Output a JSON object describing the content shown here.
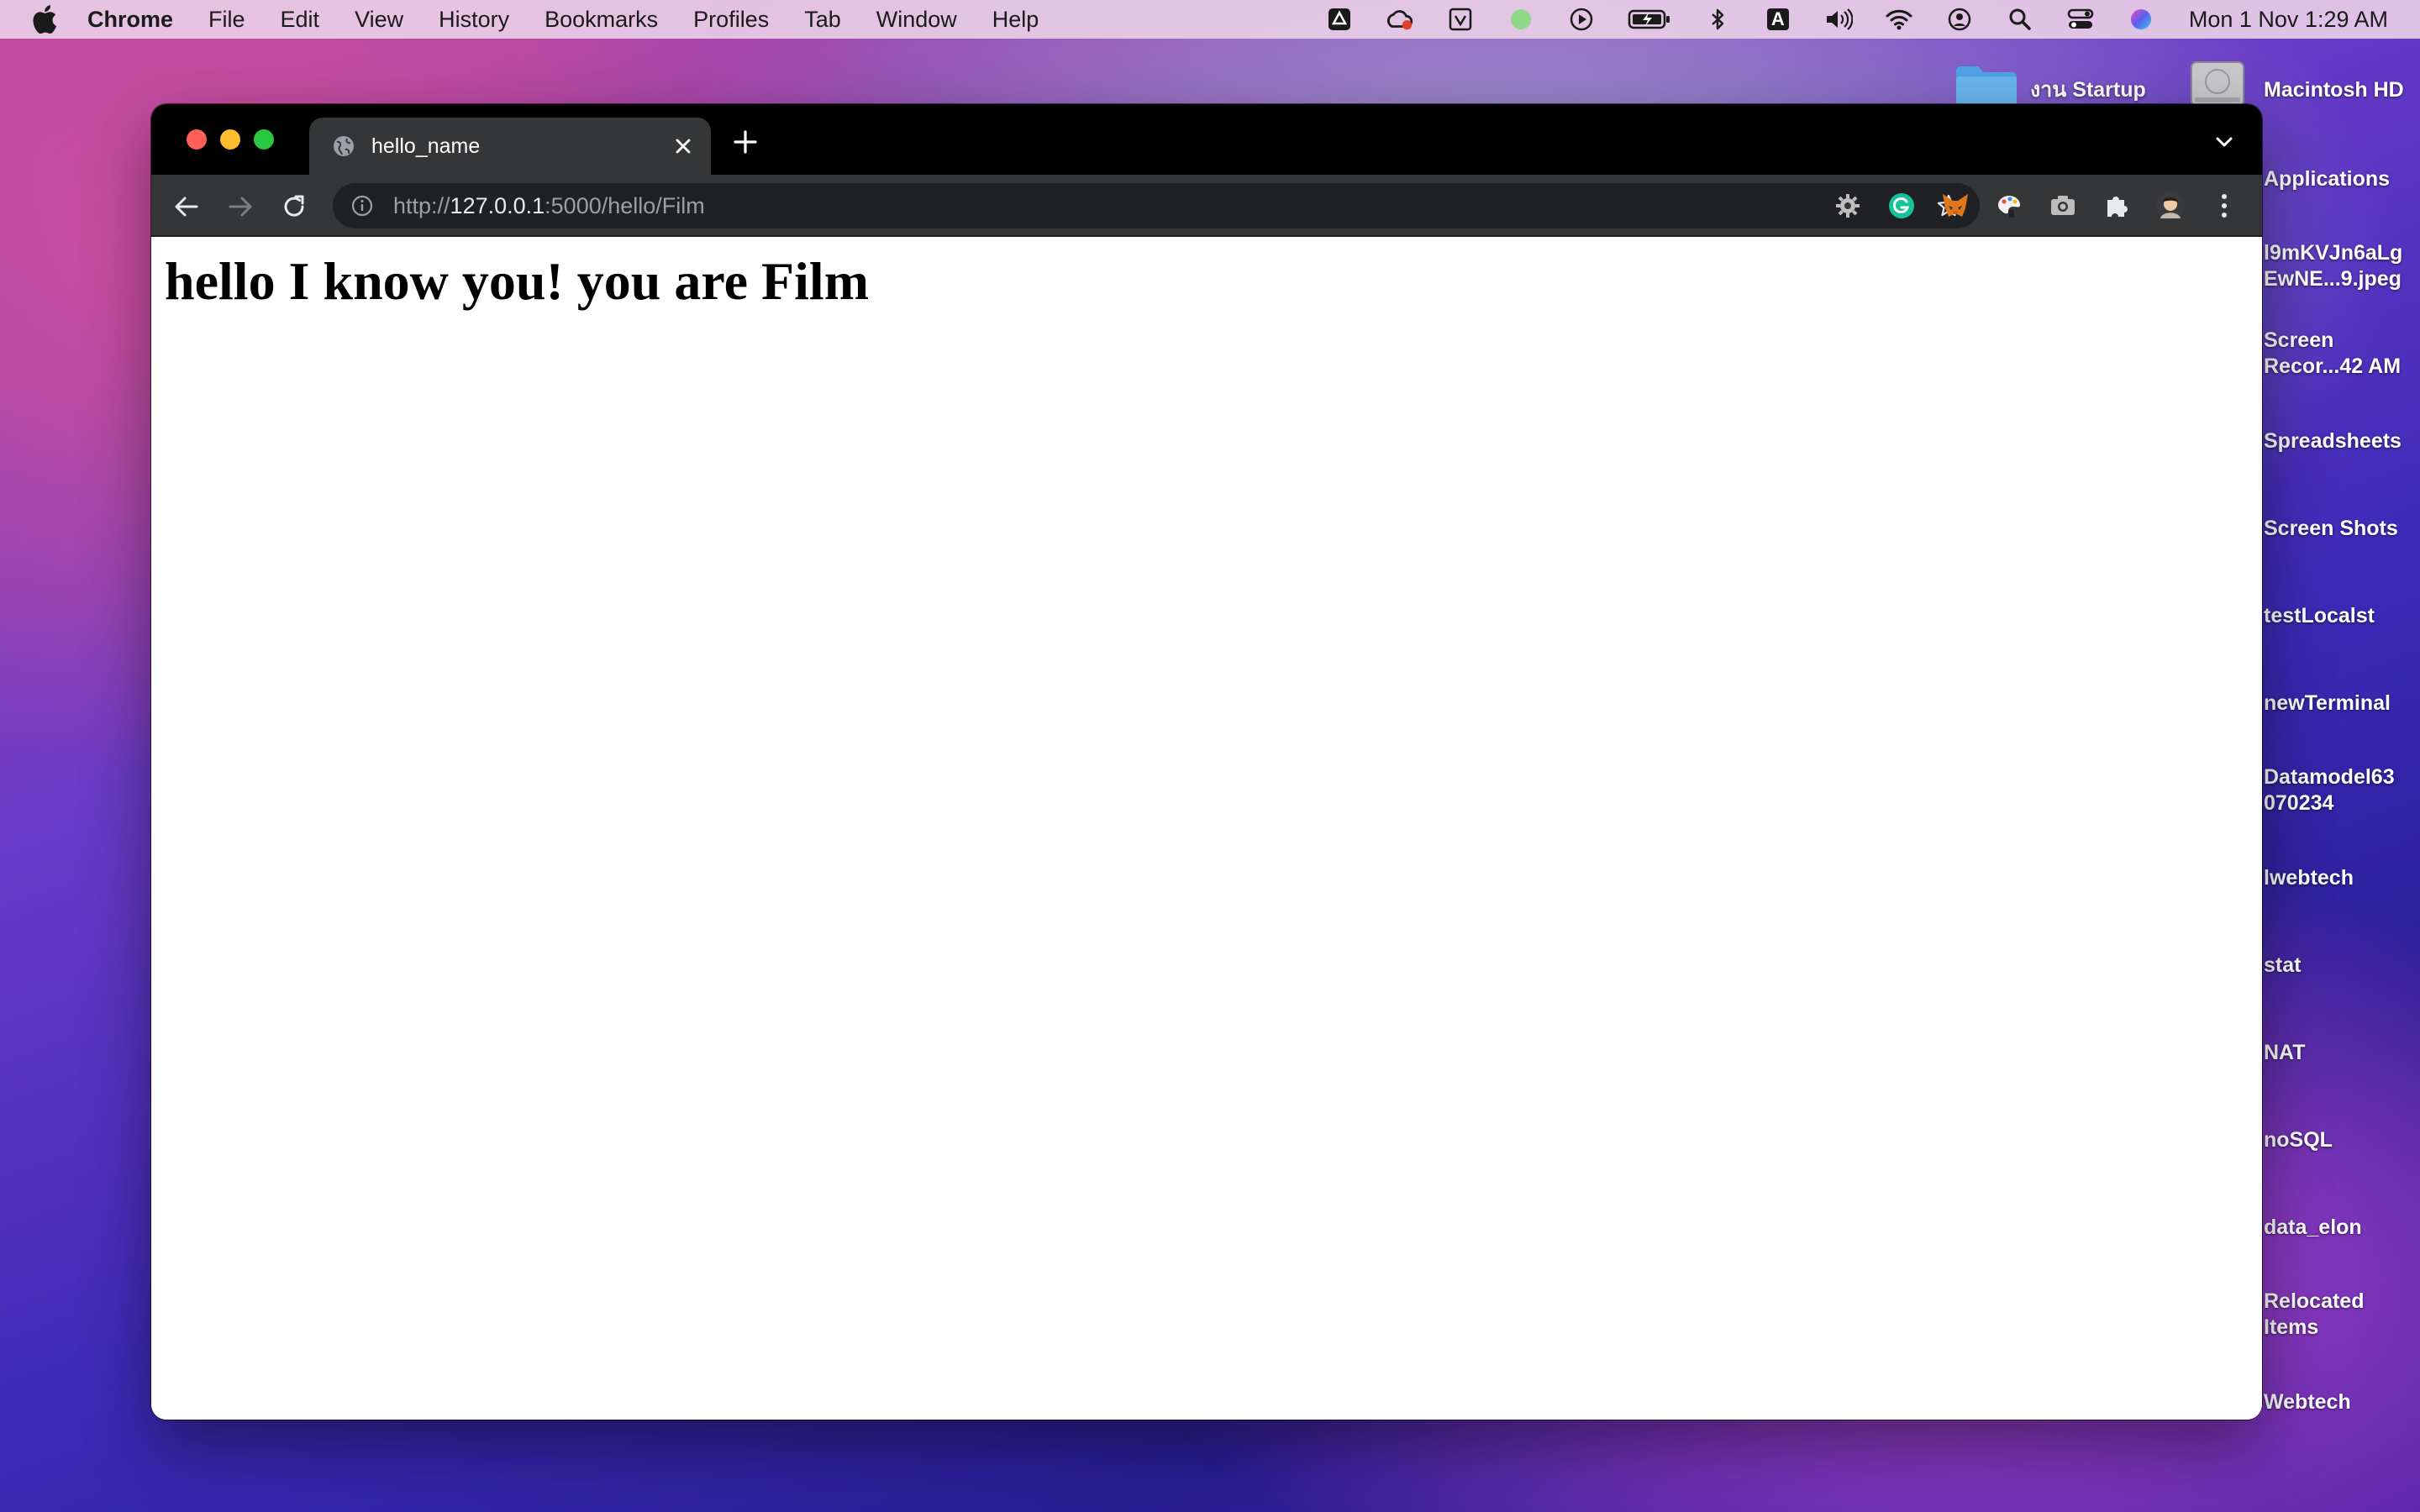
{
  "menubar": {
    "app_name": "Chrome",
    "items": [
      "File",
      "Edit",
      "View",
      "History",
      "Bookmarks",
      "Profiles",
      "Tab",
      "Window",
      "Help"
    ],
    "clock": "Mon 1 Nov  1:29 AM",
    "status_icons": [
      "drive-icon",
      "creative-cloud-icon",
      "vpn-shield-icon",
      "green-dot-icon",
      "play-icon",
      "battery-icon",
      "bluetooth-icon",
      "input-source-icon",
      "volume-icon",
      "wifi-icon",
      "user-icon",
      "spotlight-icon",
      "control-center-icon",
      "siri-icon"
    ],
    "input_source_label": "A"
  },
  "desktop": {
    "items": [
      {
        "label": "งาน Startup",
        "icon": "folder-icon"
      },
      {
        "label": "Macintosh HD",
        "icon": "hard-drive-icon"
      },
      {
        "label": "Applications"
      },
      {
        "label": "l9mKVJn6aLg\nEwNE...9.jpeg"
      },
      {
        "label": "Screen\nRecor...42 AM"
      },
      {
        "label": "Spreadsheets"
      },
      {
        "label": "Screen Shots"
      },
      {
        "label": "testLocalst"
      },
      {
        "label": "newTerminal"
      },
      {
        "label": "Datamodel63\n070234"
      },
      {
        "label": "lwebtech"
      },
      {
        "label": "stat"
      },
      {
        "label": "NAT"
      },
      {
        "label": "noSQL"
      },
      {
        "label": "data_elon"
      },
      {
        "label": "Relocated\nItems"
      },
      {
        "label": "Webtech"
      }
    ]
  },
  "browser": {
    "tab": {
      "title": "hello_name"
    },
    "url": {
      "scheme": "http://",
      "host": "127.0.0.1",
      "rest": ":5000/hello/Film"
    },
    "extensions": [
      "settings-extension-icon",
      "grammarly-icon",
      "metamask-icon",
      "paint-extension-icon",
      "camera-extension-icon",
      "extensions-puzzle-icon",
      "profile-avatar-icon",
      "more-menu-icon"
    ]
  },
  "page": {
    "heading": "hello I know you! you are Film"
  },
  "colors": {
    "tabstrip": "#000000",
    "toolbar": "#353638",
    "omnibox": "#202124",
    "traffic_close": "#ff5f57",
    "traffic_min": "#febc2e",
    "traffic_max": "#28c840"
  }
}
